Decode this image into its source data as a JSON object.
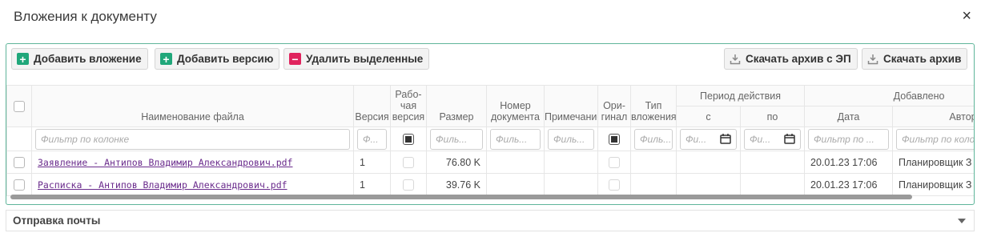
{
  "dialog": {
    "title": "Вложения к документу",
    "close": "×"
  },
  "toolbar": {
    "add_attachment": "Добавить вложение",
    "add_version": "Добавить версию",
    "delete_selected": "Удалить выделенные",
    "download_ep": "Скачать архив с ЭП",
    "download": "Скачать архив"
  },
  "columns": {
    "filename": "Наименование файла",
    "version": "Версия",
    "working_1": "Рабо-",
    "working_2": "чая",
    "working_3": "версия",
    "size": "Размер",
    "doc_no_1": "Номер",
    "doc_no_2": "документа",
    "note": "Примечание",
    "orig_1": "Ори-",
    "orig_2": "гинал",
    "type_1": "Тип",
    "type_2": "вложения",
    "period": "Период действия",
    "period_from": "с",
    "period_to": "по",
    "added": "Добавлено",
    "added_date": "Дата",
    "added_author": "Автор"
  },
  "filters": {
    "filename": "Фильтр по колонке",
    "version": "Ф...",
    "size": "Филь...",
    "doc_no": "Филь...",
    "note": "Филь...",
    "type": "Филь...",
    "period_from": "Фи...",
    "period_to": "Фи...",
    "date": "Фильтр по ...",
    "author": "Фильтр по коло"
  },
  "rows": [
    {
      "filename": "Заявление - Антипов Владимир Александрович.pdf",
      "version": "1",
      "size": "76.80 K",
      "date": "20.01.23 17:06",
      "author": "Планировщик З"
    },
    {
      "filename": "Расписка - Антипов Владимир Александрович.pdf",
      "version": "1",
      "size": "39.76 K",
      "date": "20.01.23 17:06",
      "author": "Планировщик З"
    }
  ],
  "mail": {
    "title": "Отправка почты"
  },
  "colors": {
    "accent": "#20a77a",
    "danger": "#e0245e",
    "link": "#6a2b8c",
    "border": "#5fb59a"
  }
}
